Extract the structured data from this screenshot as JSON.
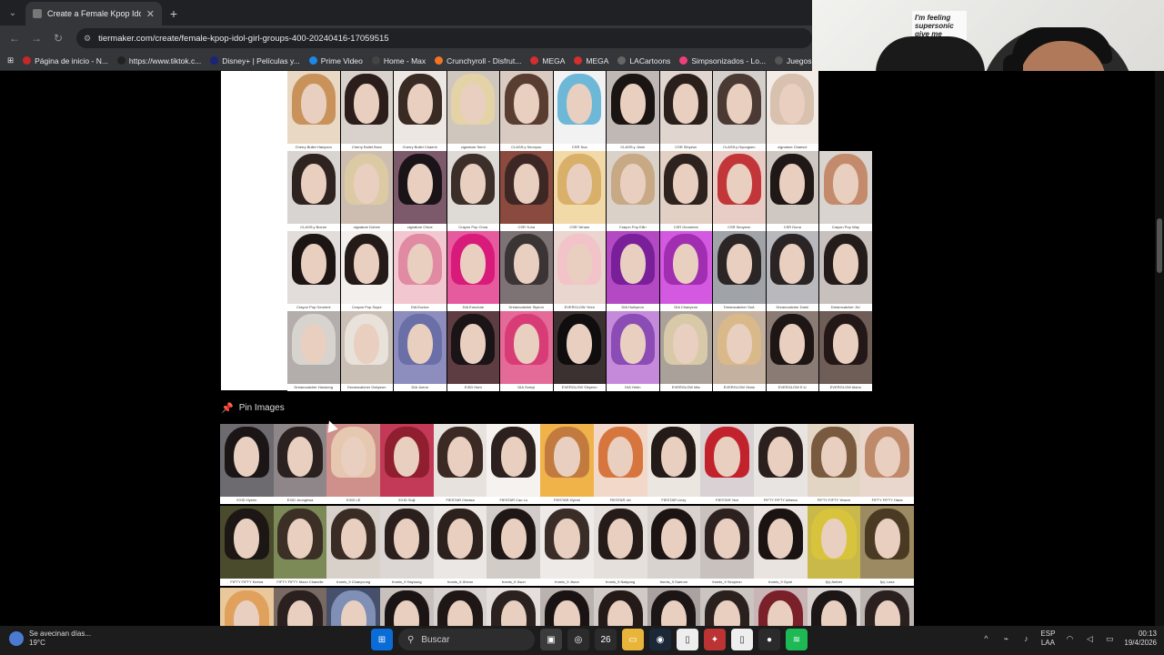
{
  "browser": {
    "tab_title": "Create a Female Kpop Idol Girl",
    "url": "tiermaker.com/create/female-kpop-idol-girl-groups-400-20240416-17059515",
    "bookmarks": [
      {
        "label": "Página de inicio - N...",
        "color": "#c62828"
      },
      {
        "label": "https://www.tiktok.c...",
        "color": "#222"
      },
      {
        "label": "Disney+ | Películas y...",
        "color": "#1a237e"
      },
      {
        "label": "Prime Video",
        "color": "#1e88e5"
      },
      {
        "label": "Home - Max",
        "color": "#444"
      },
      {
        "label": "Crunchyroll - Disfrut...",
        "color": "#f47521"
      },
      {
        "label": "MEGA",
        "color": "#d32f2f"
      },
      {
        "label": "MEGA",
        "color": "#d32f2f"
      },
      {
        "label": "LACartoons",
        "color": "#666"
      },
      {
        "label": "Simpsonizados - Lo...",
        "color": "#ec407a"
      },
      {
        "label": "Juegos",
        "color": "#555"
      }
    ]
  },
  "webcam": {
    "poster_text": "I'm feeling supersonic give me gin&tonic"
  },
  "tier": {
    "cards": [
      {
        "cap": "Cherry Bullet Haeyoon",
        "hair": "#c9925a",
        "bg": "#e8d8c4"
      },
      {
        "cap": "Cherry Bullet Bora",
        "hair": "#2b1d1a",
        "bg": "#d9d1cc"
      },
      {
        "cap": "Cherry Bullet Chaerin",
        "hair": "#3a2a24",
        "bg": "#ece7e2"
      },
      {
        "cap": "cignature Semi",
        "hair": "#e5d3a8",
        "bg": "#cfc7bd"
      },
      {
        "cap": "CLASS:y Seonyou",
        "hair": "#5a3d31",
        "bg": "#d9cbc2"
      },
      {
        "cap": "CSR Sua",
        "hair": "#6db7d7",
        "bg": "#f2f2f2"
      },
      {
        "cap": "CLASS:y Jimin",
        "hair": "#1a1412",
        "bg": "#bfb8b4"
      },
      {
        "cap": "CSR Sihyeon",
        "hair": "#2a1f1b",
        "bg": "#e0d6cf"
      },
      {
        "cap": "CLASS:y Hyungseo",
        "hair": "#4a3a33",
        "bg": "#d5cfcc"
      },
      {
        "cap": "cignature Chaesol",
        "hair": "#d8c1ae",
        "bg": "#f3ece6"
      },
      {
        "cap": "",
        "hair": "#000",
        "bg": "#000"
      },
      {
        "cap": "CLASS:y Boeun",
        "hair": "#2f2320",
        "bg": "#d8d4d2"
      },
      {
        "cap": "cignature Dohee",
        "hair": "#dccaa5",
        "bg": "#cdbdb0"
      },
      {
        "cap": "cignature Chloe",
        "hair": "#1a1418",
        "bg": "#7d5a6b"
      },
      {
        "cap": "Crayon Pop Choa",
        "hair": "#3c2f29",
        "bg": "#dedad6"
      },
      {
        "cap": "CSR Yuna",
        "hair": "#3d2724",
        "bg": "#8b4a3e"
      },
      {
        "cap": "CSR Yeham",
        "hair": "#d8b06a",
        "bg": "#f1d9a8"
      },
      {
        "cap": "Crayon Pop Ellin",
        "hair": "#c8a985",
        "bg": "#dad2c8"
      },
      {
        "cap": "CSR Geumhee",
        "hair": "#2d221e",
        "bg": "#e3d0c4"
      },
      {
        "cap": "CSR Seoyeon",
        "hair": "#c2363a",
        "bg": "#e8ccc6"
      },
      {
        "cap": "CSR Duna",
        "hair": "#1f1816",
        "bg": "#cfc7c2"
      },
      {
        "cap": "Crayon Pop Way",
        "hair": "#c38b6b",
        "bg": "#d9d4cf"
      },
      {
        "cap": "Crayon Pop Geummi",
        "hair": "#1c1514",
        "bg": "#e2ddda"
      },
      {
        "cap": "Crayon Pop Soyul",
        "hair": "#241a17",
        "bg": "#f2efec"
      },
      {
        "cap": "DIA Eunice",
        "hair": "#e08aa3",
        "bg": "#f2c7cf"
      },
      {
        "cap": "DIA Eunchae",
        "hair": "#d81b7a",
        "bg": "#e65b9d"
      },
      {
        "cap": "Dreamcatcher Siyeon",
        "hair": "#3b3434",
        "bg": "#7d7374"
      },
      {
        "cap": "EVERGLOW Yiren",
        "hair": "#f2c3c8",
        "bg": "#e9d6cf"
      },
      {
        "cap": "DIA Huihyeon",
        "hair": "#7a1f9a",
        "bg": "#b34ac4"
      },
      {
        "cap": "DIA Chaeyeon",
        "hair": "#a12db0",
        "bg": "#d35ae0"
      },
      {
        "cap": "Dreamcatcher SuA",
        "hair": "#2b2526",
        "bg": "#a0a4a8"
      },
      {
        "cap": "Dreamcatcher Dami",
        "hair": "#2a2425",
        "bg": "#b9b9bd"
      },
      {
        "cap": "Dreamcatcher JiU",
        "hair": "#231c1b",
        "bg": "#c7c0bd"
      },
      {
        "cap": "Dreamcatcher Handong",
        "hair": "#d7d3cf",
        "bg": "#b3aeab"
      },
      {
        "cap": "Dreamcatcher Gahyeon",
        "hair": "#e9e2da",
        "bg": "#c9bfb5"
      },
      {
        "cap": "DIA Jueun",
        "hair": "#6b6fa8",
        "bg": "#8d8ebd"
      },
      {
        "cap": "EXID Hani",
        "hair": "#1a1416",
        "bg": "#5d3c42"
      },
      {
        "cap": "DIA Somyi",
        "hair": "#d83c76",
        "bg": "#e46a98"
      },
      {
        "cap": "EVERGLOW Sihyeon",
        "hair": "#0f0d0d",
        "bg": "#3a3130"
      },
      {
        "cap": "DIA Yebin",
        "hair": "#8b4cb5",
        "bg": "#c58ad9"
      },
      {
        "cap": "EVERGLOW Mia",
        "hair": "#d8c9a8",
        "bg": "#a9a19a"
      },
      {
        "cap": "EVERGLOW Onda",
        "hair": "#d9b98a",
        "bg": "#c4b19f"
      },
      {
        "cap": "EVERGLOW E:U",
        "hair": "#1d1614",
        "bg": "#8a7c75"
      },
      {
        "cap": "EVERGLOW Aisha",
        "hair": "#231817",
        "bg": "#6f5d57"
      }
    ]
  },
  "pool": {
    "header": "Pin Images",
    "cards": [
      {
        "cap": "EXID Hyerin",
        "hair": "#1b1515",
        "bg": "#6d6a70"
      },
      {
        "cap": "EXID Jeonghwa",
        "hair": "#2a2120",
        "bg": "#8e8688"
      },
      {
        "cap": "EXID LE",
        "hair": "#e6c7b0",
        "bg": "#cf8f8a"
      },
      {
        "cap": "EXID Solji",
        "hair": "#8f1e2e",
        "bg": "#c23a57"
      },
      {
        "cap": "FIESTAR Cheska",
        "hair": "#3a2a23",
        "bg": "#e8e2de"
      },
      {
        "cap": "FIESTAR Cao Lu",
        "hair": "#2c211e",
        "bg": "#f5f2f0"
      },
      {
        "cap": "FIESTAR Hyemi",
        "hair": "#c27a3f",
        "bg": "#f0b34a"
      },
      {
        "cap": "FIESTAR Jei",
        "hair": "#d6763e",
        "bg": "#f2d8c8"
      },
      {
        "cap": "FIESTAR Linzy",
        "hair": "#241a17",
        "bg": "#ece6e1"
      },
      {
        "cap": "FIESTAR Yezi",
        "hair": "#c2222c",
        "bg": "#d9d1d3"
      },
      {
        "cap": "FIFTY FIFTY Athena",
        "hair": "#2b201d",
        "bg": "#e8e4e1"
      },
      {
        "cap": "FIFTY FIFTY Yewon",
        "hair": "#7a5a3f",
        "bg": "#e2d5c3"
      },
      {
        "cap": "FIFTY FIFTY Hana",
        "hair": "#bf8a6a",
        "bg": "#e9d6cc"
      },
      {
        "cap": "FIFTY FIFTY Keena",
        "hair": "#1c1614",
        "bg": "#4a4a2c"
      },
      {
        "cap": "FIFTY FIFTY Moon Chanelle",
        "hair": "#3b2f26",
        "bg": "#7c8a58"
      },
      {
        "cap": "fromis_9 Chaeyoung",
        "hair": "#3a2b25",
        "bg": "#d7d1ca"
      },
      {
        "cap": "fromis_9 Hayoung",
        "hair": "#2a1f1c",
        "bg": "#dcd7d4"
      },
      {
        "cap": "fromis_9 Jiheon",
        "hair": "#2d211d",
        "bg": "#ebe7e4"
      },
      {
        "cap": "fromis_9 Jisun",
        "hair": "#1f1715",
        "bg": "#d2ccc8"
      },
      {
        "cap": "fromis_9 Jiwon",
        "hair": "#3a2c27",
        "bg": "#eeeae7"
      },
      {
        "cap": "fromis_9 Nakyung",
        "hair": "#251b19",
        "bg": "#e6e0dc"
      },
      {
        "cap": "fromis_9 Saerom",
        "hair": "#1c1413",
        "bg": "#d9d3d0"
      },
      {
        "cap": "fromis_9 Seoyeon",
        "hair": "#2c211f",
        "bg": "#c9c1be"
      },
      {
        "cap": "fromis_9 Gyuri",
        "hair": "#1a1312",
        "bg": "#e9e4e0"
      },
      {
        "cap": "f(x) Amber",
        "hair": "#d8c43c",
        "bg": "#c9b94a"
      },
      {
        "cap": "f(x) Luna",
        "hair": "#4a3a24",
        "bg": "#9c8a62"
      },
      {
        "cap": "",
        "hair": "#e0a15c",
        "bg": "#e9c99c"
      },
      {
        "cap": "",
        "hair": "#2a2020",
        "bg": "#786a62"
      },
      {
        "cap": "",
        "hair": "#7f8fb5",
        "bg": "#46506a"
      },
      {
        "cap": "",
        "hair": "#1a1414",
        "bg": "#c7c0bd"
      },
      {
        "cap": "",
        "hair": "#1e1716",
        "bg": "#d7d2cf"
      },
      {
        "cap": "",
        "hair": "#2b2220",
        "bg": "#e4dfdc"
      },
      {
        "cap": "",
        "hair": "#1a1313",
        "bg": "#b9b2af"
      },
      {
        "cap": "",
        "hair": "#241b19",
        "bg": "#d1cbc8"
      },
      {
        "cap": "",
        "hair": "#1c1515",
        "bg": "#a9a2a0"
      },
      {
        "cap": "",
        "hair": "#2a201e",
        "bg": "#cbc5c2"
      },
      {
        "cap": "",
        "hair": "#7a2028",
        "bg": "#c9b5b5"
      },
      {
        "cap": "",
        "hair": "#1d1616",
        "bg": "#d8d3d0"
      },
      {
        "cap": "",
        "hair": "#2a2020",
        "bg": "#bcb4b1"
      }
    ]
  },
  "taskbar": {
    "weather_line1": "Se avecinan días...",
    "weather_line2": "19°C",
    "search": "Buscar",
    "calendar_badge": "26",
    "lang1": "ESP",
    "lang2": "LAA",
    "time": "00:13",
    "date": "19/4/2026"
  }
}
